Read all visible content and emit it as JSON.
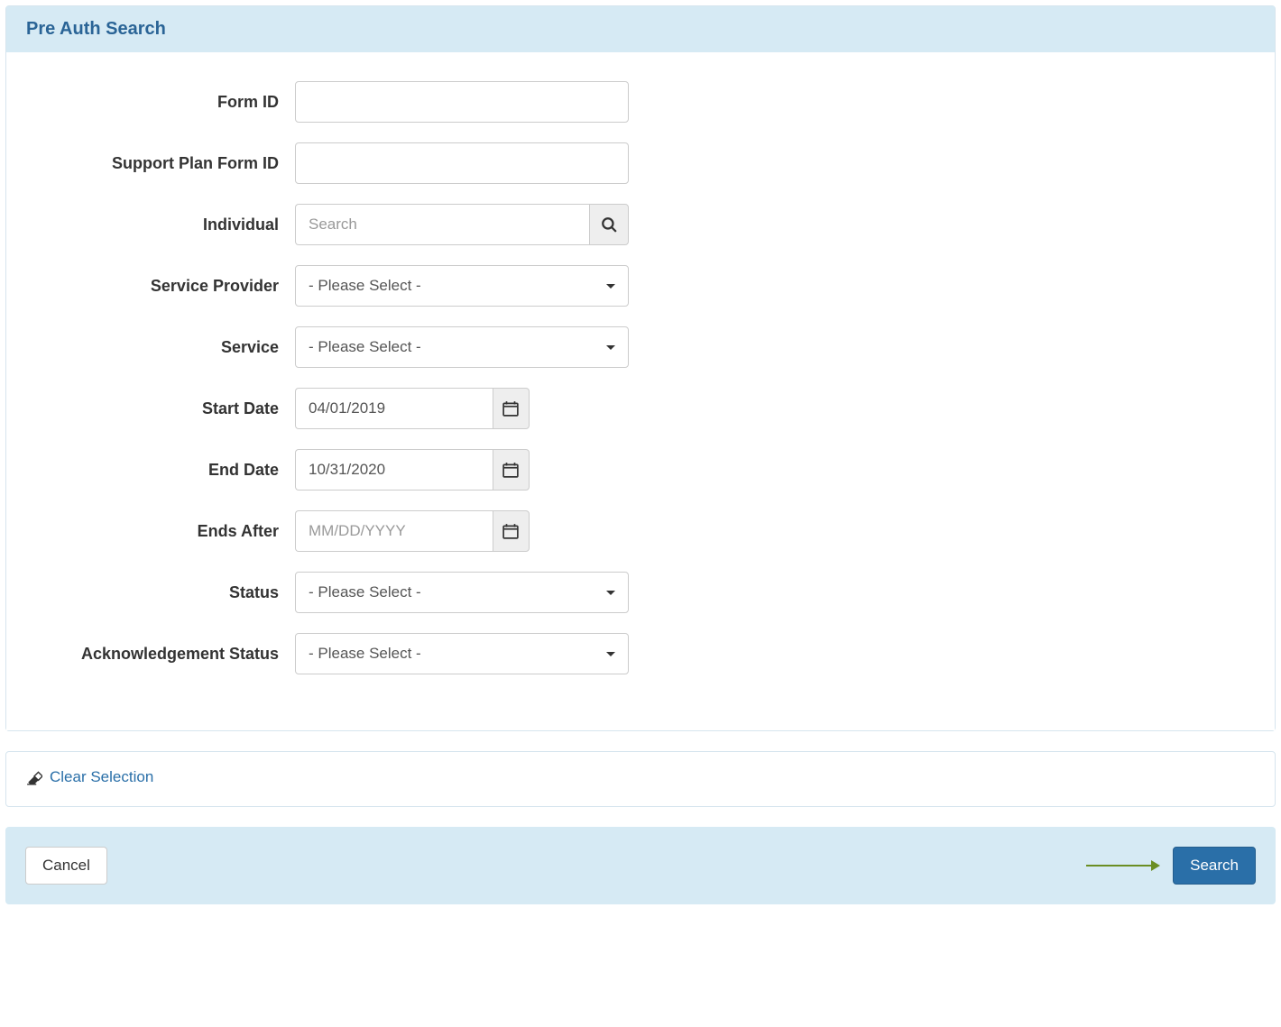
{
  "header": {
    "title": "Pre Auth Search"
  },
  "form": {
    "form_id": {
      "label": "Form ID",
      "value": ""
    },
    "support_plan_form_id": {
      "label": "Support Plan Form ID",
      "value": ""
    },
    "individual": {
      "label": "Individual",
      "placeholder": "Search",
      "value": ""
    },
    "service_provider": {
      "label": "Service Provider",
      "selected": "- Please Select -"
    },
    "service": {
      "label": "Service",
      "selected": "- Please Select -"
    },
    "start_date": {
      "label": "Start Date",
      "value": "04/01/2019"
    },
    "end_date": {
      "label": "End Date",
      "value": "10/31/2020"
    },
    "ends_after": {
      "label": "Ends After",
      "placeholder": "MM/DD/YYYY",
      "value": ""
    },
    "status": {
      "label": "Status",
      "selected": "- Please Select -"
    },
    "ack_status": {
      "label": "Acknowledgement Status",
      "selected": "- Please Select -"
    }
  },
  "actions": {
    "clear_selection": "Clear Selection",
    "cancel": "Cancel",
    "search": "Search"
  },
  "icons": {
    "search": "search-icon",
    "calendar": "calendar-icon",
    "eraser": "eraser-icon"
  }
}
